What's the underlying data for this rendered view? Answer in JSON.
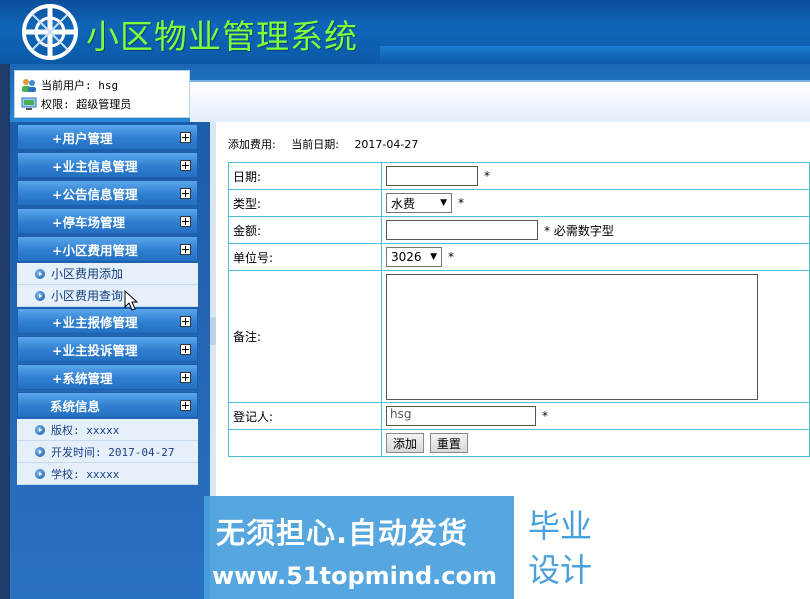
{
  "app": {
    "title": "小区物业管理系统"
  },
  "user": {
    "current_user_label": "当前用户: hsg",
    "role_label": "权限: 超级管理员"
  },
  "sidebar": {
    "menu": [
      {
        "label": "+用户管理"
      },
      {
        "label": "+业主信息管理"
      },
      {
        "label": "+公告信息管理"
      },
      {
        "label": "+停车场管理"
      },
      {
        "label": "+小区费用管理"
      }
    ],
    "fee_submenu": [
      {
        "label": "小区费用添加"
      },
      {
        "label": "小区费用查询"
      }
    ],
    "menu2": [
      {
        "label": "+业主报修管理"
      },
      {
        "label": "+业主投诉管理"
      },
      {
        "label": "+系统管理"
      }
    ],
    "sysinfo": {
      "label": "系统信息",
      "items": [
        {
          "label": "版权: xxxxx"
        },
        {
          "label": "开发时间: 2017-04-27"
        },
        {
          "label": "学校: xxxxx"
        }
      ]
    }
  },
  "content": {
    "section_title": "添加费用:",
    "current_date_label": "当前日期:",
    "current_date": "2017-04-27",
    "form": {
      "date_label": "日期:",
      "date_value": "",
      "type_label": "类型:",
      "type_value": "水费",
      "amount_label": "金额:",
      "amount_value": "",
      "amount_hint": "* 必需数字型",
      "unit_label": "单位号:",
      "unit_value": "3026",
      "remark_label": "备注:",
      "remark_value": "",
      "registrar_label": "登记人:",
      "registrar_value": "hsg",
      "required_mark": "*",
      "add_button": "添加",
      "reset_button": "重置"
    }
  },
  "watermark": {
    "line1": "无须担心.自动发货",
    "line2": "www.51topmind.com",
    "badge_line1": "毕业",
    "badge_line2": "设计"
  },
  "colors": {
    "title_green": "#7dff3a",
    "border_cyan": "#4ac0d7",
    "header_blue": "#0f66b8"
  }
}
